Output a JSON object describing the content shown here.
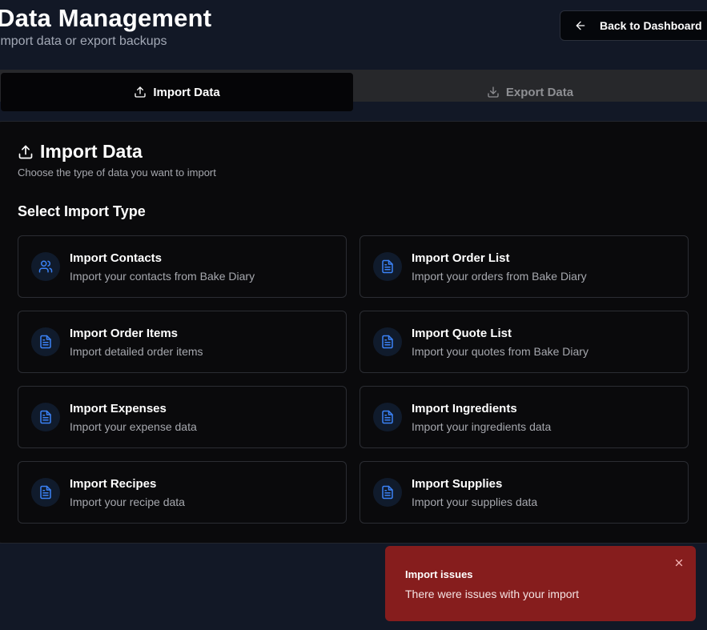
{
  "header": {
    "title": "Data Management",
    "subtitle": "Import data or export backups",
    "back_button": {
      "label": "Back to Dashboard",
      "icon": "arrow-left-icon"
    }
  },
  "tabs": [
    {
      "label": "Import Data",
      "icon": "upload-icon",
      "active": true
    },
    {
      "label": "Export Data",
      "icon": "download-icon",
      "active": false
    }
  ],
  "import_card": {
    "title": "Import Data",
    "title_icon": "upload-icon",
    "description": "Choose the type of data you want to import",
    "section_title": "Select Import Type",
    "options": [
      {
        "title": "Import Contacts",
        "description": "Import your contacts from Bake Diary",
        "icon": "users-icon"
      },
      {
        "title": "Import Order List",
        "description": "Import your orders from Bake Diary",
        "icon": "document-icon"
      },
      {
        "title": "Import Order Items",
        "description": "Import detailed order items",
        "icon": "document-icon"
      },
      {
        "title": "Import Quote List",
        "description": "Import your quotes from Bake Diary",
        "icon": "document-icon"
      },
      {
        "title": "Import Expenses",
        "description": "Import your expense data",
        "icon": "document-icon"
      },
      {
        "title": "Import Ingredients",
        "description": "Import your ingredients data",
        "icon": "document-icon"
      },
      {
        "title": "Import Recipes",
        "description": "Import your recipe data",
        "icon": "document-icon"
      },
      {
        "title": "Import Supplies",
        "description": "Import your supplies data",
        "icon": "document-icon"
      }
    ]
  },
  "toast": {
    "title": "Import issues",
    "message": "There were issues with your import",
    "close_icon": "close-icon"
  },
  "colors": {
    "background": "#121826",
    "accent_icon": "#3b82f6",
    "toast_error": "#861d1d"
  }
}
